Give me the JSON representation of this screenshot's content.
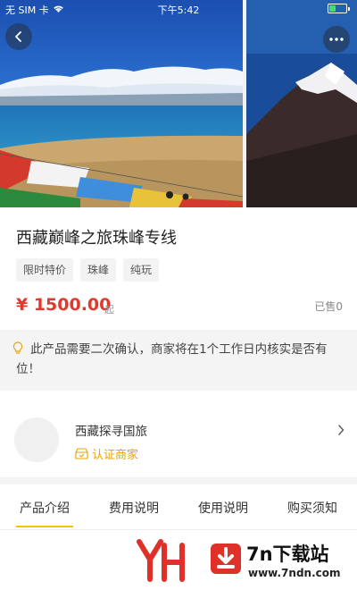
{
  "status_bar": {
    "carrier": "无 SIM 卡",
    "time": "下午5:42"
  },
  "product": {
    "title": "西藏巅峰之旅珠峰专线",
    "tags": [
      "限时特价",
      "珠峰",
      "纯玩"
    ],
    "price": "¥ 1500.00",
    "price_suffix": "起",
    "sold": "已售0"
  },
  "notice": {
    "text": "此产品需要二次确认，商家将在1个工作日内核实是否有位！"
  },
  "merchant": {
    "name": "西藏探寻国旅",
    "badge": "认证商家"
  },
  "tabs": [
    {
      "label": "产品介绍",
      "active": true
    },
    {
      "label": "费用说明",
      "active": false
    },
    {
      "label": "使用说明",
      "active": false
    },
    {
      "label": "购买须知",
      "active": false
    }
  ],
  "watermark": {
    "brand": "7n下载站",
    "url": "www.7ndn.com"
  },
  "colors": {
    "price": "#e3382b",
    "accent": "#f5c400",
    "badge": "#e8a300"
  }
}
